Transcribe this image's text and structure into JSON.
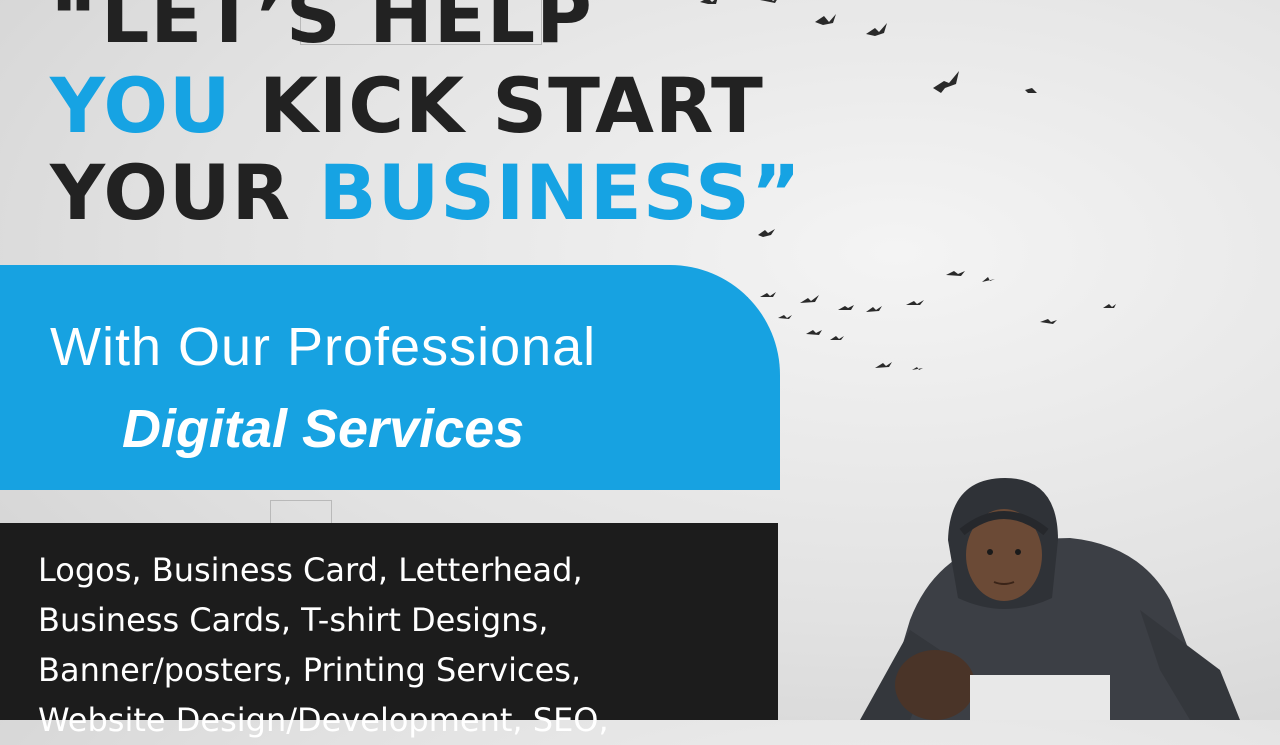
{
  "headline": {
    "line1": "“LET’S HELP",
    "line2_blue": "YOU",
    "line2_dark": "KICK START",
    "line3_dark": "YOUR",
    "line3_blue": "BUSINESS”"
  },
  "subheading": {
    "line1": "With Our Professional",
    "line2": "Digital Services"
  },
  "services": [
    "Logos, Business Card, Letterhead,",
    "Business Cards, T-shirt Designs,",
    "Banner/posters, Printing Services,",
    "Website Design/Development, SEO,"
  ],
  "colors": {
    "accent": "#16a3e3",
    "panel_blue": "#17a2e1",
    "panel_dark": "#1c1c1c",
    "text_dark": "#222222",
    "background": "#e6e6e6"
  },
  "images": {
    "birds": "flock-of-birds",
    "person": "man-in-hoodie-sprint-start"
  }
}
